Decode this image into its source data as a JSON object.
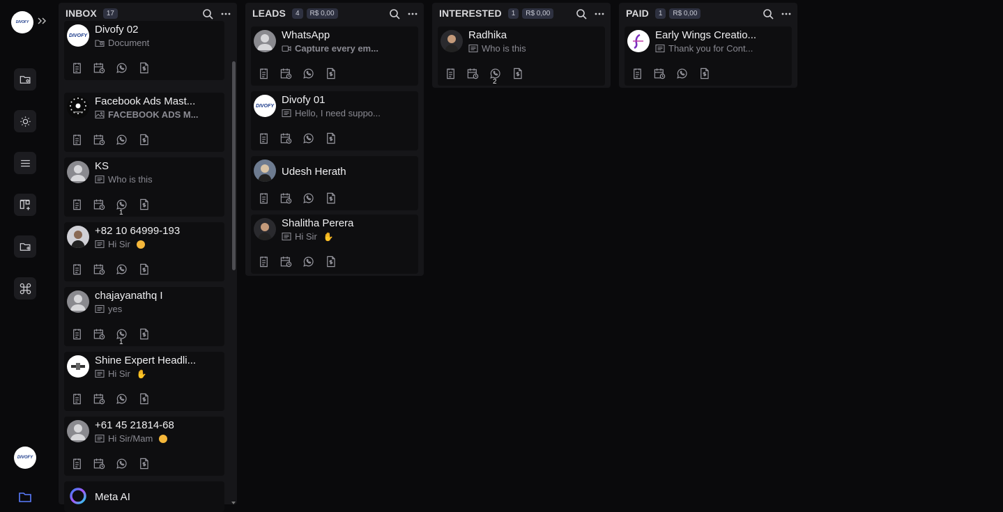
{
  "sidebar": {
    "logo_text": "DIVOFY",
    "bottom_avatar_text": "DIVOFY",
    "items": [
      {
        "icon": "folder-settings-icon"
      },
      {
        "icon": "sun-icon"
      },
      {
        "icon": "menu-icon"
      },
      {
        "icon": "board-add-icon"
      },
      {
        "icon": "folder-add-icon"
      },
      {
        "icon": "command-icon"
      }
    ]
  },
  "columns": [
    {
      "title": "INBOX",
      "count": "17",
      "money": "",
      "cards": [
        {
          "name": "Divofy 02",
          "sub": "Document",
          "sub_icon": "folder-icon",
          "avatar": "DIVOFY",
          "badge": ""
        },
        {
          "name": "Facebook Ads Mast...",
          "sub": "FACEBOOK ADS M...",
          "sub_icon": "image-icon",
          "avatar": "FB",
          "badge": ""
        },
        {
          "name": "KS",
          "sub": "Who is this",
          "sub_icon": "message-icon",
          "avatar": "person",
          "badge": "1"
        },
        {
          "name": "+82 10 64999-193",
          "sub": "Hi Sir",
          "sub_icon": "message-icon",
          "avatar": "photo",
          "badge": ""
        },
        {
          "name": "chajayanathq I",
          "sub": "yes",
          "sub_icon": "message-icon",
          "avatar": "person",
          "badge": "1"
        },
        {
          "name": "Shine Expert Headli...",
          "sub": "Hi Sir",
          "sub_icon": "message-icon",
          "avatar": "SE",
          "badge": ""
        },
        {
          "name": "+61 45 21814-68",
          "sub": "Hi Sir/Mam",
          "sub_icon": "message-icon",
          "avatar": "person",
          "badge": ""
        },
        {
          "name": "Meta AI",
          "sub": "",
          "sub_icon": "",
          "avatar": "meta",
          "badge": ""
        }
      ]
    },
    {
      "title": "LEADS",
      "count": "4",
      "money": "R$ 0,00",
      "cards": [
        {
          "name": "WhatsApp",
          "sub": "Capture every em...",
          "sub_icon": "video-icon",
          "avatar": "person",
          "badge": ""
        },
        {
          "name": "Divofy 01",
          "sub": "Hello, I need suppo...",
          "sub_icon": "message-icon",
          "avatar": "DIVOFY",
          "badge": ""
        },
        {
          "name": "Udesh Herath",
          "sub": "",
          "sub_icon": "",
          "avatar": "photo",
          "badge": ""
        },
        {
          "name": "Shalitha Perera",
          "sub": "Hi Sir",
          "sub_icon": "message-icon",
          "avatar": "photo",
          "badge": ""
        }
      ]
    },
    {
      "title": "INTERESTED",
      "count": "1",
      "money": "R$ 0,00",
      "cards": [
        {
          "name": "Radhika",
          "sub": "Who is this",
          "sub_icon": "message-icon",
          "avatar": "photo",
          "badge": "2"
        }
      ]
    },
    {
      "title": "PAID",
      "count": "1",
      "money": "R$ 0,00",
      "cards": [
        {
          "name": "Early Wings Creatio...",
          "sub": "Thank you for Cont...",
          "sub_icon": "message-icon",
          "avatar": "EW",
          "badge": ""
        }
      ]
    }
  ],
  "card_actions": [
    "notes-icon",
    "schedule-icon",
    "whatsapp-icon",
    "invoice-icon"
  ],
  "colors": {
    "background": "#0a0a0c",
    "column": "#161619",
    "card": "#0e0e10",
    "badge": "#2e3140"
  }
}
